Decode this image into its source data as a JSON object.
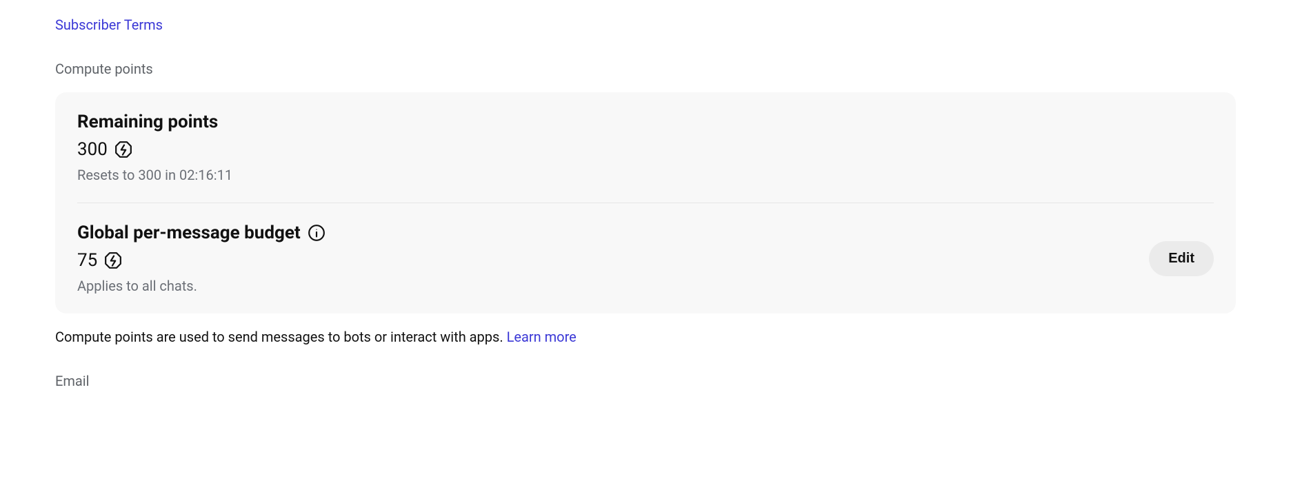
{
  "top_link": "Subscriber Terms",
  "compute_points": {
    "label": "Compute points",
    "remaining": {
      "title": "Remaining points",
      "value": "300",
      "reset_line": "Resets to 300 in 02:16:11"
    },
    "budget": {
      "title": "Global per-message budget",
      "value": "75",
      "applies_line": "Applies to all chats.",
      "edit_label": "Edit"
    },
    "description": "Compute points are used to send messages to bots or interact with apps. ",
    "learn_more": "Learn more"
  },
  "email_label": "Email"
}
